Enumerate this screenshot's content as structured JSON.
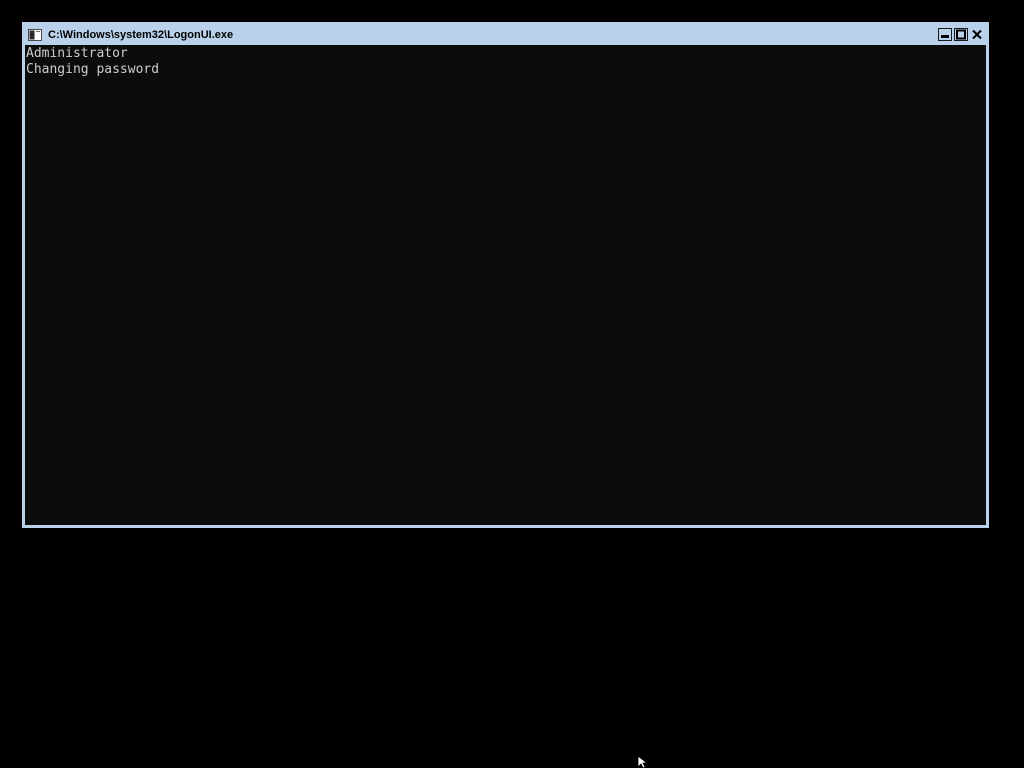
{
  "window": {
    "title": "C:\\Windows\\system32\\LogonUI.exe",
    "controls": {
      "minimize": "minimize-icon",
      "maximize": "maximize-icon",
      "close": "close-icon"
    }
  },
  "console": {
    "lines": [
      "Administrator",
      "Changing password"
    ]
  },
  "colors": {
    "desktop_background": "#000000",
    "titlebar": "#b9d1ea",
    "console_background": "#0c0c0c",
    "console_text": "#cccccc"
  },
  "icons": {
    "app": "console-window-icon",
    "cursor": "mouse-pointer-icon"
  }
}
